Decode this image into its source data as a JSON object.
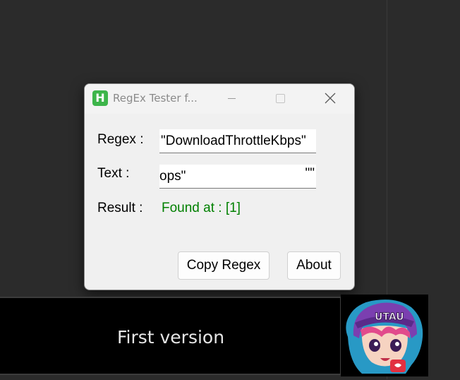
{
  "window": {
    "title": "RegEx Tester f...",
    "app_icon_letter": "H",
    "icon_color": "#3db54a",
    "controls": {
      "minimize": "—",
      "maximize": "□",
      "close": "×"
    }
  },
  "form": {
    "regex_label": "Regex :",
    "regex_value": "\"DownloadThrottleKbps\"",
    "text_label": "Text :",
    "text_value_left": "ops\"",
    "text_value_right": "\"\"",
    "result_label": "Result :",
    "result_value": "Found at : [1]",
    "result_color": "#008000"
  },
  "buttons": {
    "copy_regex": "Copy Regex",
    "about": "About"
  },
  "banner": {
    "text": "First version"
  },
  "mascot": {
    "icon": "utau-mascot-icon",
    "logo_text": "UTAU"
  }
}
